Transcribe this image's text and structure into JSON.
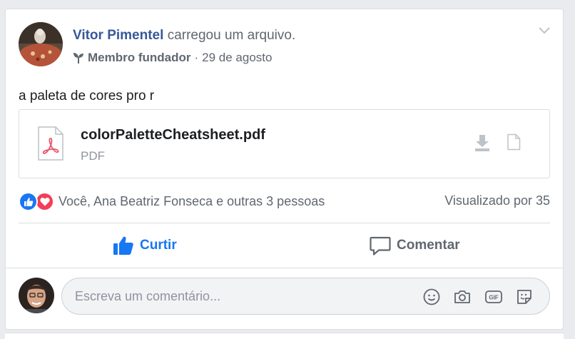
{
  "post": {
    "author": "Vitor Pimentel",
    "action": "carregou um arquivo.",
    "badge": "Membro fundador",
    "separator": "·",
    "date": "29 de agosto",
    "text": "a paleta de cores pro r"
  },
  "attachment": {
    "file_name": "colorPaletteCheatsheet.pdf",
    "file_type": "PDF"
  },
  "reactions": {
    "summary": "Você, Ana Beatriz Fonseca e outras 3 pessoas",
    "views": "Visualizado por 35"
  },
  "actions": {
    "like_label": "Curtir",
    "comment_label": "Comentar"
  },
  "comment": {
    "placeholder": "Escreva um comentário..."
  },
  "colors": {
    "author": "#365899",
    "like_blue": "#1877f2",
    "love_red": "#f33e58",
    "pdf_red": "#e9566b"
  },
  "icons": [
    "chevron-down-icon",
    "sprout-icon",
    "pdf-file-icon",
    "download-icon",
    "document-icon",
    "like-reaction-icon",
    "love-reaction-icon",
    "thumbs-up-icon",
    "comment-bubble-icon",
    "emoji-icon",
    "camera-icon",
    "gif-icon",
    "sticker-icon"
  ]
}
